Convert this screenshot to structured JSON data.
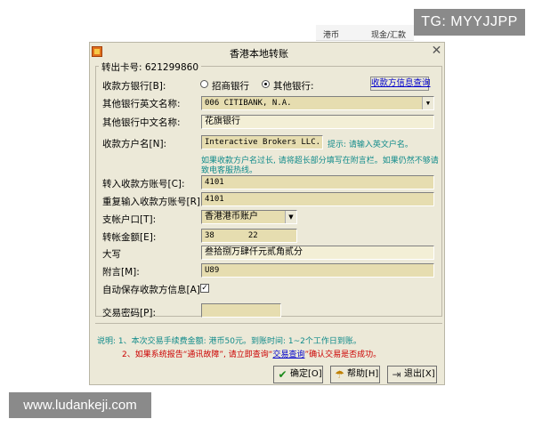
{
  "background": {
    "col1": "港币",
    "col2": "现金/汇款"
  },
  "watermarks": {
    "top": "TG: MYYJJPP",
    "bottom": "www.ludankeji.com"
  },
  "dialog": {
    "title": "香港本地转账",
    "close_glyph": "✕",
    "group_title": "转出卡号: 621299860",
    "payee_bank_label": "收款方银行[B]:",
    "radio_cmb": "招商银行",
    "radio_other": "其他银行:",
    "payee_info_query": "收款方信息查询",
    "other_bank_en_label": "其他银行英文名称:",
    "other_bank_en_value": "006 CITIBANK, N.A.",
    "other_bank_cn_label": "其他银行中文名称:",
    "other_bank_cn_value": "花旗银行",
    "payee_name_label": "收款方户名[N]:",
    "payee_name_value": "Interactive Brokers LLC.",
    "payee_name_hint": "提示: 请输入英文户名。",
    "long_name_hint_1": "如果收款方户名过长, 请将超长部分填写在附言栏。如果仍然不够请",
    "long_name_hint_2": "致电客服热线。",
    "payee_account_label": "转入收款方账号[C]:",
    "payee_account_value": "4101",
    "payee_account_confirm_label": "重复输入收款方账号[R]:",
    "payee_account_confirm_value": "4101",
    "pay_account_label": "支帐户口[T]:",
    "pay_account_value": "香港港币账户",
    "amount_label": "转帐金额[E]:",
    "amount_int": "38",
    "amount_dec": "22",
    "capital_label": "大写",
    "capital_value": "叁拾捌万肆仟元贰角贰分",
    "remark_label": "附言[M]:",
    "remark_value": "U89",
    "auto_save_label": "自动保存收款方信息[A]:",
    "auto_save_mark": "✓",
    "password_label": "交易密码[P]:",
    "note_1": "说明: 1、本次交易手续费金额: 港币50元。到账时间: 1~2个工作日到账。",
    "note_2_prefix": "2、如果系统报告“通讯故障”, 请立即查询“",
    "note_2_link": "交易查询",
    "note_2_suffix": "”确认交易是否成功。",
    "buttons": {
      "ok": "确定[O]",
      "help": "帮助[H]",
      "exit": "退出[X]"
    }
  }
}
